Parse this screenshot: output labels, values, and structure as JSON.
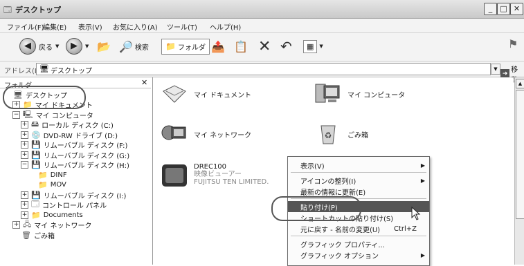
{
  "window": {
    "title": "デスクトップ"
  },
  "menu": [
    "ファイル(F)",
    "編集(E)",
    "表示(V)",
    "お気に入り(A)",
    "ツール(T)",
    "ヘルプ(H)"
  ],
  "toolbar": {
    "back": "戻る",
    "search": "検索",
    "folders": "フォルダ"
  },
  "address": {
    "label": "アドレス(D)",
    "value": "デスクトップ",
    "go": "移動"
  },
  "folders": {
    "header": "フォルダ",
    "tree": [
      {
        "label": "デスクトップ",
        "icon": "desktop-icon",
        "indent": 0,
        "expander": ""
      },
      {
        "label": "マイ ドキュメント",
        "icon": "documents-icon",
        "indent": 1,
        "expander": "+"
      },
      {
        "label": "マイ コンピュータ",
        "icon": "computer-icon",
        "indent": 1,
        "expander": "−"
      },
      {
        "label": "ローカル ディスク (C:)",
        "icon": "drive-icon",
        "indent": 2,
        "expander": "+"
      },
      {
        "label": "DVD-RW ドライブ (D:)",
        "icon": "dvd-icon",
        "indent": 2,
        "expander": "+"
      },
      {
        "label": "リムーバブル ディスク (F:)",
        "icon": "removable-icon",
        "indent": 2,
        "expander": "+"
      },
      {
        "label": "リムーバブル ディスク (G:)",
        "icon": "removable-icon",
        "indent": 2,
        "expander": "+"
      },
      {
        "label": "リムーバブル ディスク (H:)",
        "icon": "removable-icon",
        "indent": 2,
        "expander": "−"
      },
      {
        "label": "DINF",
        "icon": "folder-icon",
        "indent": 3,
        "expander": ""
      },
      {
        "label": "MOV",
        "icon": "folder-icon",
        "indent": 3,
        "expander": ""
      },
      {
        "label": "リムーバブル ディスク (I:)",
        "icon": "removable-icon",
        "indent": 2,
        "expander": "+"
      },
      {
        "label": "コントロール パネル",
        "icon": "control-panel-icon",
        "indent": 2,
        "expander": "+"
      },
      {
        "label": "Documents",
        "icon": "folder-icon",
        "indent": 2,
        "expander": "+"
      },
      {
        "label": "マイ ネットワーク",
        "icon": "network-icon",
        "indent": 1,
        "expander": "+"
      },
      {
        "label": "ごみ箱",
        "icon": "recycle-bin-icon",
        "indent": 1,
        "expander": ""
      }
    ]
  },
  "items": {
    "mydocs": "マイ ドキュメント",
    "mycomputer": "マイ コンピュータ",
    "network": "マイ ネットワーク",
    "recycle": "ごみ箱",
    "drec": {
      "name": "DREC100",
      "type": "映像ビューアー",
      "company": "FUJITSU TEN LIMITED."
    }
  },
  "context_menu": [
    {
      "label": "表示(V)",
      "submenu": true
    },
    {
      "sep": true
    },
    {
      "label": "アイコンの整列(I)",
      "submenu": true
    },
    {
      "label": "最新の情報に更新(E)"
    },
    {
      "sep": true
    },
    {
      "label": "貼り付け(P)",
      "highlight": true
    },
    {
      "label": "ショートカットの貼り付け(S)"
    },
    {
      "label": "元に戻す - 名前の変更(U)",
      "shortcut": "Ctrl+Z"
    },
    {
      "sep": true
    },
    {
      "label": "グラフィック プロパティ..."
    },
    {
      "label": "グラフィック オプション",
      "submenu": true
    }
  ],
  "colors": {
    "highlight": "#555555",
    "annotation": "#555555"
  }
}
